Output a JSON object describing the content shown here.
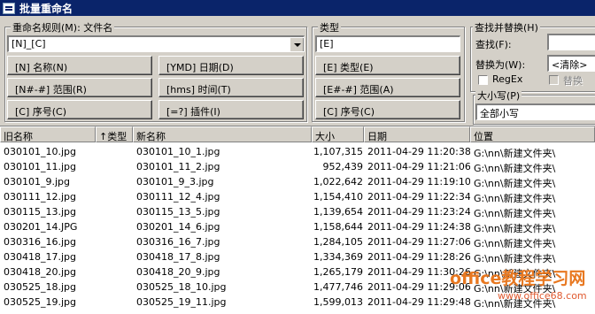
{
  "window": {
    "title": "批量重命名"
  },
  "rename_rule": {
    "legend": "重命名规则(M): 文件名",
    "value": "[N]_[C]",
    "buttons": [
      "[N] 名称(N)",
      "[YMD] 日期(D)",
      "[N#-#] 范围(R)",
      "[hms] 时间(T)",
      "[C] 序号(C)",
      "[=?] 插件(I)"
    ]
  },
  "type_rule": {
    "legend": "类型",
    "value": "[E]",
    "buttons": [
      "[E] 类型(E)",
      "[E#-#] 范围(A)",
      "[C] 序号(C)"
    ]
  },
  "find_replace": {
    "legend": "查找并替换(H)",
    "find_label": "查找(F):",
    "find_value": "",
    "replace_label": "替换为(W):",
    "replace_value": "<清除>",
    "regex_label": "RegEx",
    "replace_check_label": "替换"
  },
  "case": {
    "legend": "大小写(P)",
    "value": "全部小写"
  },
  "table": {
    "headers": [
      "旧名称",
      "↑类型",
      "新名称",
      "大小",
      "日期",
      "位置"
    ],
    "rows": [
      [
        "030101_10.jpg",
        "030101_10_1.jpg",
        "1,107,315",
        "2011-04-29 11:20:38",
        "G:\\nn\\新建文件夹\\"
      ],
      [
        "030101_11.jpg",
        "030101_11_2.jpg",
        "952,439",
        "2011-04-29 11:21:06",
        "G:\\nn\\新建文件夹\\"
      ],
      [
        "030101_9.jpg",
        "030101_9_3.jpg",
        "1,022,642",
        "2011-04-29 11:19:10",
        "G:\\nn\\新建文件夹\\"
      ],
      [
        "030111_12.jpg",
        "030111_12_4.jpg",
        "1,154,410",
        "2011-04-29 11:22:34",
        "G:\\nn\\新建文件夹\\"
      ],
      [
        "030115_13.jpg",
        "030115_13_5.jpg",
        "1,139,654",
        "2011-04-29 11:23:24",
        "G:\\nn\\新建文件夹\\"
      ],
      [
        "030201_14.JPG",
        "030201_14_6.jpg",
        "1,158,644",
        "2011-04-29 11:24:38",
        "G:\\nn\\新建文件夹\\"
      ],
      [
        "030316_16.jpg",
        "030316_16_7.jpg",
        "1,284,105",
        "2011-04-29 11:27:06",
        "G:\\nn\\新建文件夹\\"
      ],
      [
        "030418_17.jpg",
        "030418_17_8.jpg",
        "1,334,369",
        "2011-04-29 11:28:26",
        "G:\\nn\\新建文件夹\\"
      ],
      [
        "030418_20.jpg",
        "030418_20_9.jpg",
        "1,265,179",
        "2011-04-29 11:30:26",
        "G:\\nn\\新建文件夹\\"
      ],
      [
        "030525_18.jpg",
        "030525_18_10.jpg",
        "1,477,746",
        "2011-04-29 11:29:06",
        "G:\\nn\\新建文件夹\\"
      ],
      [
        "030525_19.jpg",
        "030525_19_11.jpg",
        "1,599,013",
        "2011-04-29 11:29:48",
        "G:\\nn\\新建文件夹\\"
      ]
    ]
  },
  "watermark": {
    "text": "office教程学习网",
    "url": "www.office68.com"
  }
}
